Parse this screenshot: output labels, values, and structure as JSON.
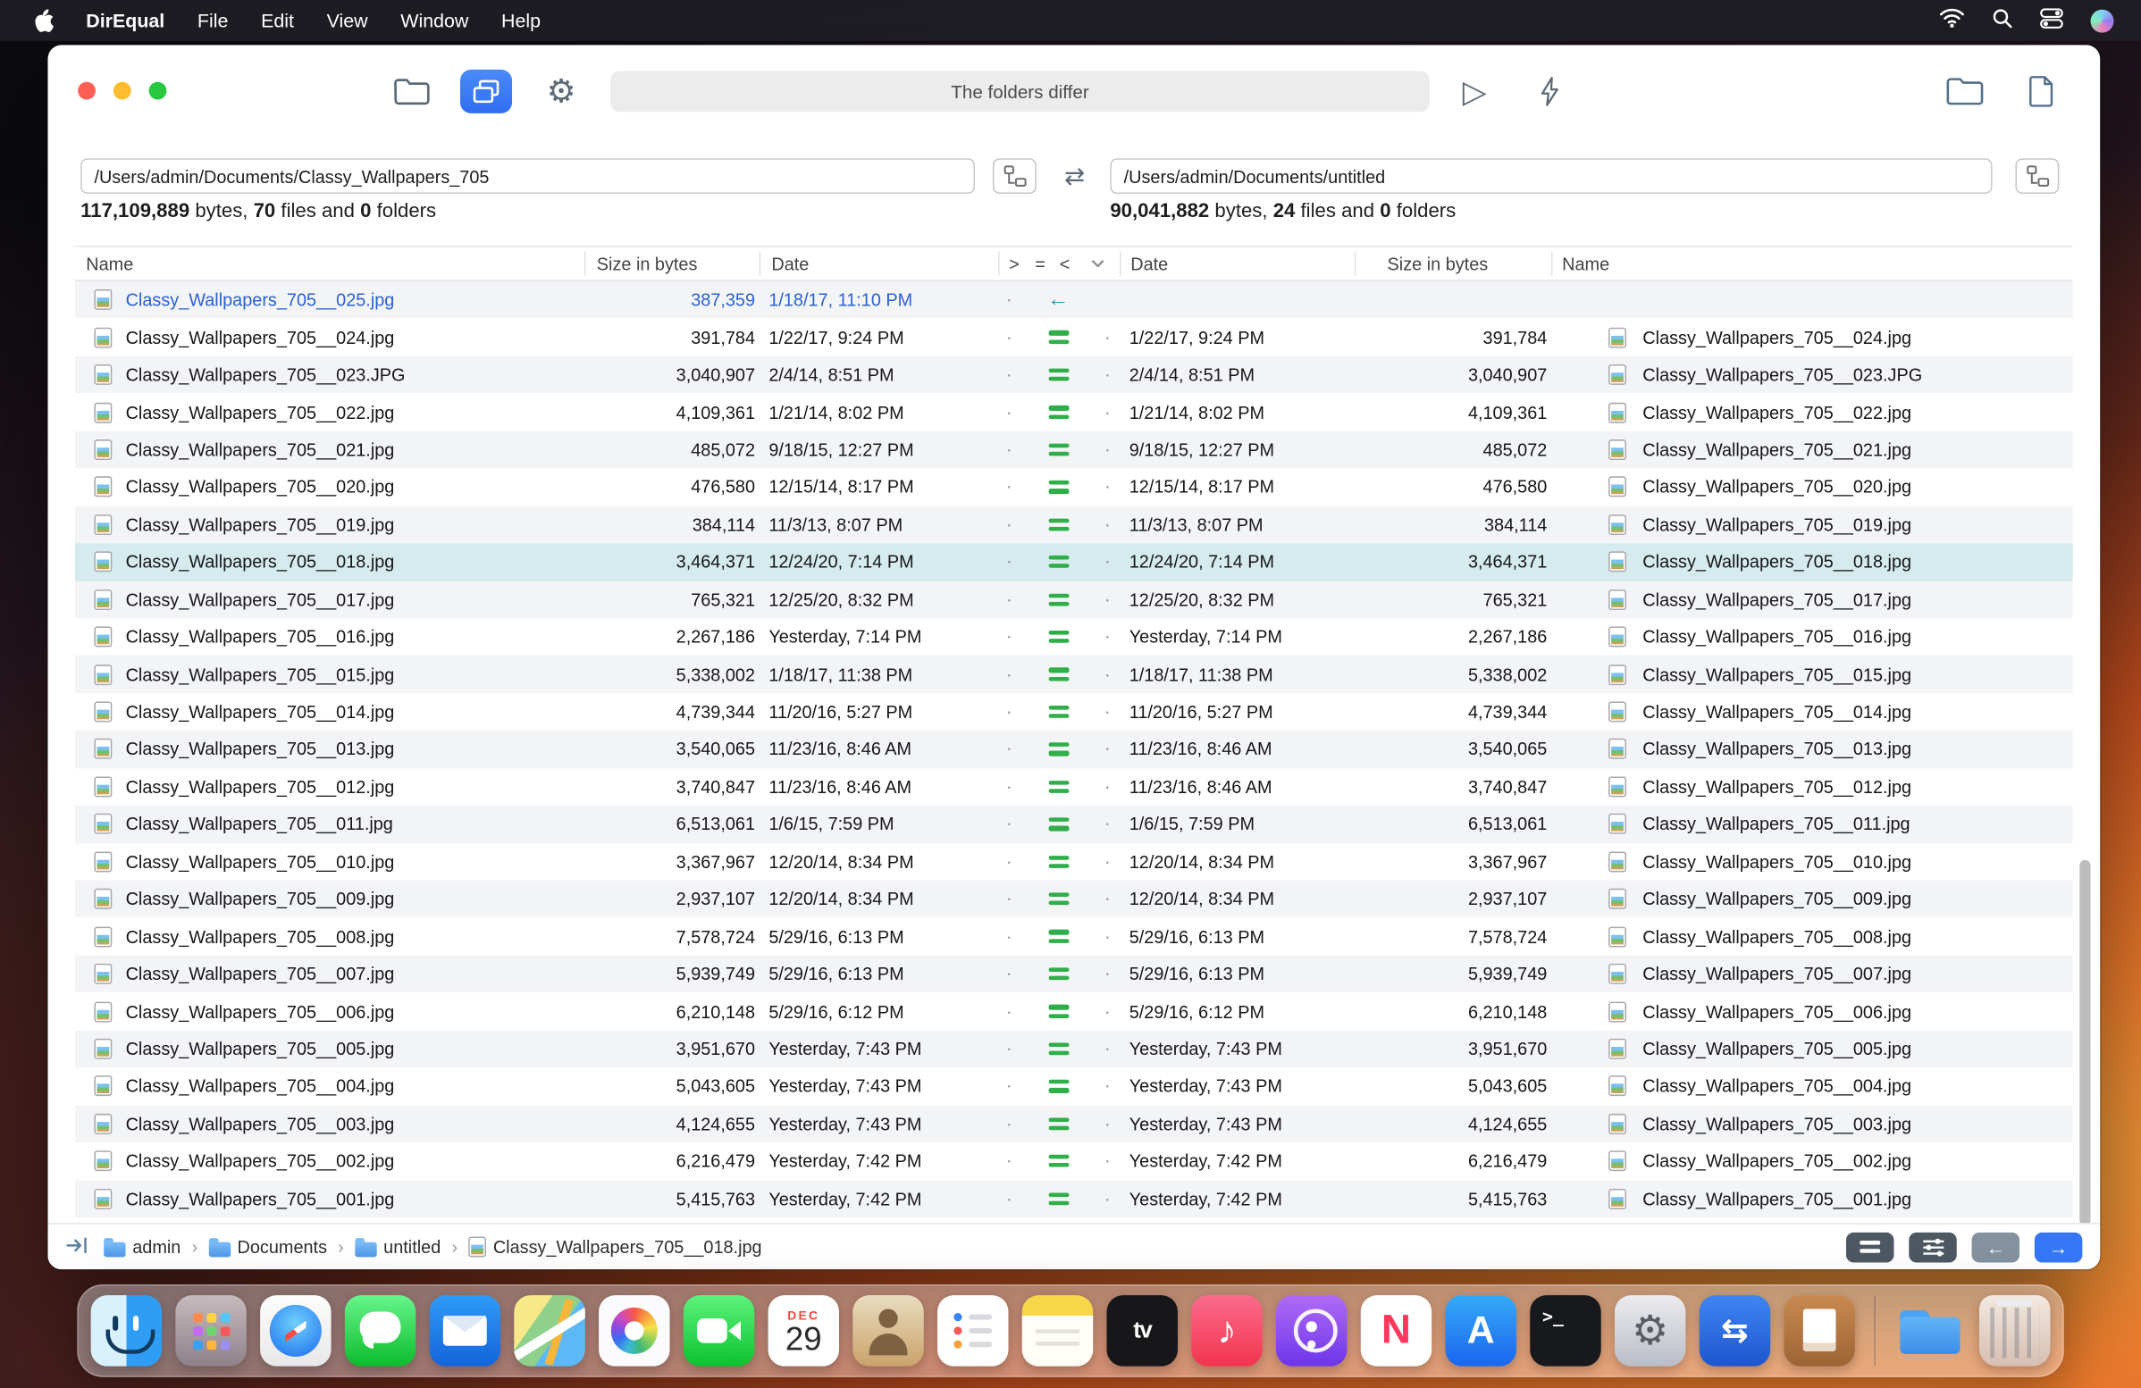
{
  "menu_bar": {
    "app_name": "DirEqual",
    "items": [
      "File",
      "Edit",
      "View",
      "Window",
      "Help"
    ]
  },
  "toolbar": {
    "status_text": "The folders differ"
  },
  "labels": {
    "bytes": "bytes,",
    "files": "files and",
    "folders": "folders"
  },
  "compare": {
    "left": {
      "path": "/Users/admin/Documents/Classy_Wallpapers_705",
      "bytes": "117,109,889",
      "files": "70",
      "folders": "0"
    },
    "right": {
      "path": "/Users/admin/Documents/untitled",
      "bytes": "90,041,882",
      "files": "24",
      "folders": "0"
    }
  },
  "glyphs": {
    "swap": "⇄",
    "play": "▷",
    "gear": "⚙",
    "back": "←",
    "forward": "→"
  },
  "table": {
    "headers": {
      "name": "Name",
      "size": "Size in bytes",
      "date": "Date",
      "gt": ">",
      "eq": "=",
      "lt": "<"
    },
    "glyphs": {
      "dot": "·",
      "left_arrow": "←"
    },
    "rows": [
      {
        "name": "Classy_Wallpapers_705__025.jpg",
        "size": "387,359",
        "date": "1/18/17, 11:10 PM",
        "status": "left_only",
        "selected": false
      },
      {
        "name": "Classy_Wallpapers_705__024.jpg",
        "size": "391,784",
        "date": "1/22/17, 9:24 PM",
        "status": "equal",
        "selected": false
      },
      {
        "name": "Classy_Wallpapers_705__023.JPG",
        "size": "3,040,907",
        "date": "2/4/14, 8:51 PM",
        "status": "equal",
        "selected": false
      },
      {
        "name": "Classy_Wallpapers_705__022.jpg",
        "size": "4,109,361",
        "date": "1/21/14, 8:02 PM",
        "status": "equal",
        "selected": false
      },
      {
        "name": "Classy_Wallpapers_705__021.jpg",
        "size": "485,072",
        "date": "9/18/15, 12:27 PM",
        "status": "equal",
        "selected": false
      },
      {
        "name": "Classy_Wallpapers_705__020.jpg",
        "size": "476,580",
        "date": "12/15/14, 8:17 PM",
        "status": "equal",
        "selected": false
      },
      {
        "name": "Classy_Wallpapers_705__019.jpg",
        "size": "384,114",
        "date": "11/3/13, 8:07 PM",
        "status": "equal",
        "selected": false
      },
      {
        "name": "Classy_Wallpapers_705__018.jpg",
        "size": "3,464,371",
        "date": "12/24/20, 7:14 PM",
        "status": "equal",
        "selected": true
      },
      {
        "name": "Classy_Wallpapers_705__017.jpg",
        "size": "765,321",
        "date": "12/25/20, 8:32 PM",
        "status": "equal",
        "selected": false
      },
      {
        "name": "Classy_Wallpapers_705__016.jpg",
        "size": "2,267,186",
        "date": "Yesterday, 7:14 PM",
        "status": "equal",
        "selected": false
      },
      {
        "name": "Classy_Wallpapers_705__015.jpg",
        "size": "5,338,002",
        "date": "1/18/17, 11:38 PM",
        "status": "equal",
        "selected": false
      },
      {
        "name": "Classy_Wallpapers_705__014.jpg",
        "size": "4,739,344",
        "date": "11/20/16, 5:27 PM",
        "status": "equal",
        "selected": false
      },
      {
        "name": "Classy_Wallpapers_705__013.jpg",
        "size": "3,540,065",
        "date": "11/23/16, 8:46 AM",
        "status": "equal",
        "selected": false
      },
      {
        "name": "Classy_Wallpapers_705__012.jpg",
        "size": "3,740,847",
        "date": "11/23/16, 8:46 AM",
        "status": "equal",
        "selected": false
      },
      {
        "name": "Classy_Wallpapers_705__011.jpg",
        "size": "6,513,061",
        "date": "1/6/15, 7:59 PM",
        "status": "equal",
        "selected": false
      },
      {
        "name": "Classy_Wallpapers_705__010.jpg",
        "size": "3,367,967",
        "date": "12/20/14, 8:34 PM",
        "status": "equal",
        "selected": false
      },
      {
        "name": "Classy_Wallpapers_705__009.jpg",
        "size": "2,937,107",
        "date": "12/20/14, 8:34 PM",
        "status": "equal",
        "selected": false
      },
      {
        "name": "Classy_Wallpapers_705__008.jpg",
        "size": "7,578,724",
        "date": "5/29/16, 6:13 PM",
        "status": "equal",
        "selected": false
      },
      {
        "name": "Classy_Wallpapers_705__007.jpg",
        "size": "5,939,749",
        "date": "5/29/16, 6:13 PM",
        "status": "equal",
        "selected": false
      },
      {
        "name": "Classy_Wallpapers_705__006.jpg",
        "size": "6,210,148",
        "date": "5/29/16, 6:12 PM",
        "status": "equal",
        "selected": false
      },
      {
        "name": "Classy_Wallpapers_705__005.jpg",
        "size": "3,951,670",
        "date": "Yesterday, 7:43 PM",
        "status": "equal",
        "selected": false
      },
      {
        "name": "Classy_Wallpapers_705__004.jpg",
        "size": "5,043,605",
        "date": "Yesterday, 7:43 PM",
        "status": "equal",
        "selected": false
      },
      {
        "name": "Classy_Wallpapers_705__003.jpg",
        "size": "4,124,655",
        "date": "Yesterday, 7:43 PM",
        "status": "equal",
        "selected": false
      },
      {
        "name": "Classy_Wallpapers_705__002.jpg",
        "size": "6,216,479",
        "date": "Yesterday, 7:42 PM",
        "status": "equal",
        "selected": false
      },
      {
        "name": "Classy_Wallpapers_705__001.jpg",
        "size": "5,415,763",
        "date": "Yesterday, 7:42 PM",
        "status": "equal",
        "selected": false
      }
    ]
  },
  "status_bar": {
    "separator": "›",
    "breadcrumb": [
      {
        "type": "folder",
        "label": "admin"
      },
      {
        "type": "folder",
        "label": "Documents"
      },
      {
        "type": "folder",
        "label": "untitled"
      },
      {
        "type": "file",
        "label": "Classy_Wallpapers_705__018.jpg"
      }
    ]
  },
  "dock": {
    "items": [
      {
        "kind": "finder",
        "name": "Finder"
      },
      {
        "kind": "launchpad",
        "name": "Launchpad"
      },
      {
        "kind": "safari",
        "name": "Safari"
      },
      {
        "kind": "messages",
        "name": "Messages"
      },
      {
        "kind": "mail",
        "name": "Mail"
      },
      {
        "kind": "maps",
        "name": "Maps"
      },
      {
        "kind": "photos",
        "name": "Photos"
      },
      {
        "kind": "facetime",
        "name": "FaceTime"
      },
      {
        "kind": "calendar",
        "name": "Calendar",
        "month": "DEC",
        "day": "29"
      },
      {
        "kind": "contacts",
        "name": "Contacts"
      },
      {
        "kind": "reminders",
        "name": "Reminders"
      },
      {
        "kind": "notes",
        "name": "Notes"
      },
      {
        "kind": "tv",
        "name": "TV",
        "glyph": "tv"
      },
      {
        "kind": "music",
        "name": "Music",
        "glyph": "♪"
      },
      {
        "kind": "podcasts",
        "name": "Podcasts"
      },
      {
        "kind": "news",
        "name": "News",
        "glyph": "N"
      },
      {
        "kind": "appstore",
        "name": "App Store",
        "glyph": "A"
      },
      {
        "kind": "terminal",
        "name": "Terminal",
        "glyph": ">_"
      },
      {
        "kind": "settings",
        "name": "System Settings",
        "glyph": "⚙"
      },
      {
        "kind": "direqual",
        "name": "DirEqual",
        "glyph": "⇆"
      },
      {
        "kind": "docapp",
        "name": "Document App"
      },
      {
        "kind": "separator"
      },
      {
        "kind": "downloads",
        "name": "Downloads"
      },
      {
        "kind": "trash",
        "name": "Trash"
      }
    ]
  },
  "colors": {
    "accent_blue": "#3577f6",
    "equal_green": "#2fae4a",
    "left_only_teal": "#2e93b4",
    "left_only_text_blue": "#2a62d0",
    "selection": "#d6ebee"
  }
}
